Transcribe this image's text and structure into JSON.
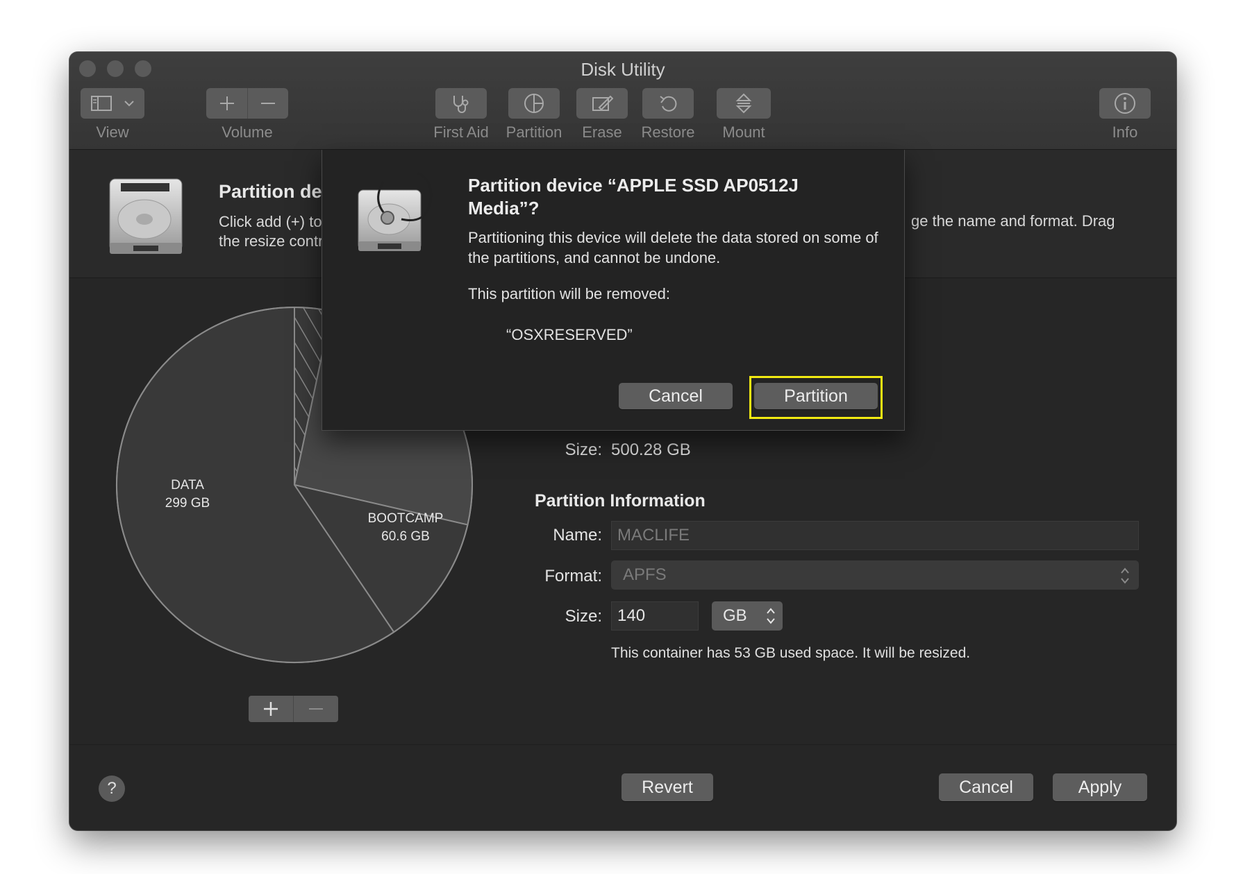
{
  "window": {
    "title": "Disk Utility"
  },
  "toolbar": {
    "view_label": "View",
    "volume_label": "Volume",
    "first_aid_label": "First Aid",
    "partition_label": "Partition",
    "erase_label": "Erase",
    "restore_label": "Restore",
    "mount_label": "Mount",
    "info_label": "Info"
  },
  "header": {
    "title": "Partition dev",
    "desc_line1": "Click add (+) to",
    "desc_line2": "the resize contr",
    "desc_right": "ge the name and format. Drag"
  },
  "chart_data": {
    "type": "pie",
    "slices": [
      {
        "label": "DATA",
        "value_text": "299 GB",
        "value": 299
      },
      {
        "label": "BOOTCAMP",
        "value_text": "60.6 GB",
        "value": 60.6
      }
    ]
  },
  "details": {
    "size_label": "Size:",
    "size_value": "500.28 GB",
    "section_title": "Partition Information",
    "name_label": "Name:",
    "name_value": "MACLIFE",
    "format_label": "Format:",
    "format_value": "APFS",
    "part_size_label": "Size:",
    "part_size_value": "140",
    "unit_value": "GB",
    "note": "This container has 53 GB used space. It will be resized."
  },
  "footer": {
    "help": "?",
    "revert_label": "Revert",
    "cancel_label": "Cancel",
    "apply_label": "Apply"
  },
  "dialog": {
    "title": "Partition device “APPLE SSD AP0512J Media”?",
    "message": "Partitioning this device will delete the data stored on some of the partitions, and cannot be undone.",
    "message2": "This partition will be removed:",
    "partition_name": "“OSXRESERVED”",
    "cancel_label": "Cancel",
    "partition_label": "Partition"
  },
  "colors": {
    "highlight": "#f2ea12",
    "window_bg": "#262626"
  }
}
